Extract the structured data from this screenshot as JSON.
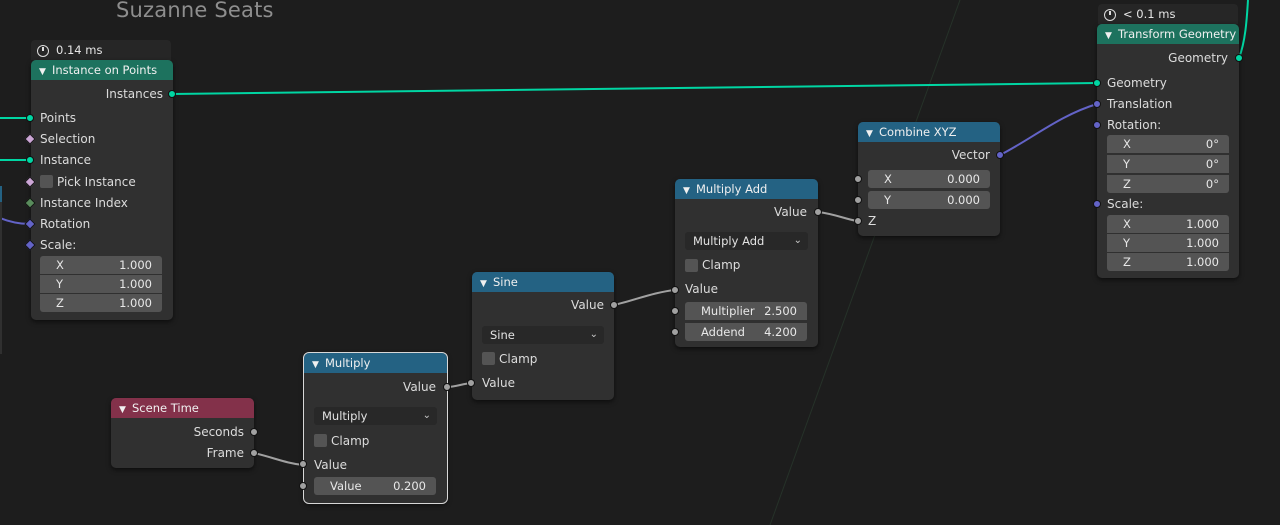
{
  "title": "Suzanne Seats",
  "colors": {
    "geometry_header": "#1d725e",
    "function_header": "#246283",
    "input_header": "#83314a",
    "geometry_socket": "#00d6a3",
    "float_socket": "#a1a1a1",
    "vector_socket": "#6363c7"
  },
  "instance_on_points": {
    "timing": "0.14 ms",
    "header": "Instance on Points",
    "out_instances": "Instances",
    "in_points": "Points",
    "in_selection": "Selection",
    "in_instance": "Instance",
    "in_pick_instance": "Pick Instance",
    "in_instance_index": "Instance Index",
    "in_rotation": "Rotation",
    "in_scale": "Scale:",
    "scale": [
      {
        "label": "X",
        "value": "1.000"
      },
      {
        "label": "Y",
        "value": "1.000"
      },
      {
        "label": "Z",
        "value": "1.000"
      }
    ]
  },
  "scene_time": {
    "header": "Scene Time",
    "out_seconds": "Seconds",
    "out_frame": "Frame"
  },
  "multiply": {
    "header": "Multiply",
    "out_value": "Value",
    "operation": "Multiply",
    "clamp": "Clamp",
    "in_value": "Value",
    "field_label": "Value",
    "field_value": "0.200"
  },
  "sine": {
    "header": "Sine",
    "out_value": "Value",
    "operation": "Sine",
    "clamp": "Clamp",
    "in_value": "Value"
  },
  "multiply_add": {
    "header": "Multiply Add",
    "out_value": "Value",
    "operation": "Multiply Add",
    "clamp": "Clamp",
    "in_value": "Value",
    "multiplier_label": "Multiplier",
    "multiplier_value": "2.500",
    "addend_label": "Addend",
    "addend_value": "4.200"
  },
  "combine_xyz": {
    "header": "Combine XYZ",
    "out_vector": "Vector",
    "x_label": "X",
    "x_value": "0.000",
    "y_label": "Y",
    "y_value": "0.000",
    "in_z": "Z"
  },
  "transform_geometry": {
    "timing": "< 0.1 ms",
    "header": "Transform Geometry",
    "out_geometry": "Geometry",
    "in_geometry": "Geometry",
    "in_translation": "Translation",
    "in_rotation": "Rotation:",
    "rotation": [
      {
        "label": "X",
        "value": "0°"
      },
      {
        "label": "Y",
        "value": "0°"
      },
      {
        "label": "Z",
        "value": "0°"
      }
    ],
    "in_scale": "Scale:",
    "scale": [
      {
        "label": "X",
        "value": "1.000"
      },
      {
        "label": "Y",
        "value": "1.000"
      },
      {
        "label": "Z",
        "value": "1.000"
      }
    ]
  }
}
